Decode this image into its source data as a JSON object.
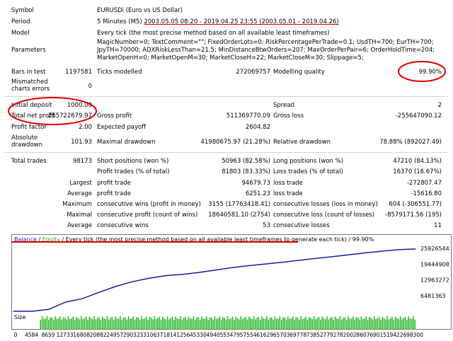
{
  "report": {
    "symbol_label": "Symbol",
    "symbol_value": "EURUSDi (Euro vs US Dollar)",
    "period_label": "Period",
    "period_prefix": "5 Minutes (M5)",
    "period_range": "2003.05.05 08:20 - 2019.04.25 23:55 (2003.05.01 - 2019.04.26)",
    "model_label": "Model",
    "model_value": "Every tick (the most precise method based on all available least timeframes)",
    "parameters_label": "Parameters",
    "parameters_value": "MagicNumber=0; TextComment=\"\"; FixedOrderLots=0; RiskPercentagePerTrade=0.1; UsdTH=700; EurTH=700; JpyTH=70000; ADXRiskLessThan=21.5; MinDistanceBtwOrders=207; MaxOrderPerPair=6; OrderHoldTime=204; MarketOpenH=0; MarketOpenM=30; MarketCloseH=22; MarketCloseM=30; Slippage=5;",
    "bars_label": "Bars in test",
    "bars_value": "1197581",
    "ticks_label": "Ticks modelled",
    "ticks_value": "272069757",
    "quality_label": "Modelling quality",
    "quality_value": "99.90%",
    "mismatch_label_1": "Mismatched",
    "mismatch_label_2": "charts errors",
    "mismatch_value": "0",
    "deposit_label": "Initial deposit",
    "deposit_value": "1000.00",
    "spread_label": "Spread",
    "spread_value": "2",
    "netprofit_label": "Total net profit",
    "netprofit_value": "255722679.97",
    "grossprofit_label": "Gross profit",
    "grossprofit_value": "511369770.09",
    "grossloss_label": "Gross loss",
    "grossloss_value": "-255647090.12",
    "pf_label": "Profit factor",
    "pf_value": "2.00",
    "payoff_label": "Expected payoff",
    "payoff_value": "2604.82",
    "absdd_label_1": "Absolute",
    "absdd_label_2": "drawdown",
    "absdd_value": "101.93",
    "maxdd_label": "Maximal drawdown",
    "maxdd_value": "41980675.97 (21.28%)",
    "reldd_label": "Relative drawdown",
    "reldd_value": "78.88% (892027.49)",
    "trades_label": "Total trades",
    "trades_value": "98173",
    "short_label": "Short positions (won %)",
    "short_value": "50963 (82.58%)",
    "long_label": "Long positions (won %)",
    "long_value": "47210 (84.13%)",
    "ptrades_label": "Profit trades (% of total)",
    "ptrades_value": "81803 (83.33%)",
    "ltrades_label": "Loss trades (% of total)",
    "ltrades_value": "16370 (16.67%)",
    "largest_label": "Largest",
    "largest_p_label": "profit trade",
    "largest_p_value": "94679.73",
    "largest_l_label": "loss trade",
    "largest_l_value": "-272807.47",
    "average_label": "Average",
    "average_p_label": "profit trade",
    "average_p_value": "6251.23",
    "average_l_label": "loss trade",
    "average_l_value": "-15616.80",
    "maximum_label": "Maximum",
    "maxwins_label": "consecutive wins (profit in money)",
    "maxwins_value": "3155 (17763418.41)",
    "maxlosses_label": "consecutive losses (loss in money)",
    "maxlosses_value": "604 (-306551.77)",
    "maximal_label": "Maximal",
    "maxprofit_label": "consecutive profit (count of wins)",
    "maxprofit_value": "18640581.10 (2754)",
    "maxloss_label": "consecutive loss (count of losses)",
    "maxloss_value": "-8579171.56 (195)",
    "avgcons_label": "Average",
    "avgwins_label": "consecutive wins",
    "avgwins_value": "53",
    "avglosses_label": "consecutive losses",
    "avglosses_value": "11"
  },
  "chart": {
    "legend_balance": "Balance",
    "legend_sep": " / ",
    "legend_equity": "Equity",
    "legend_rest": " / Every tick (the most precise method based on all available least timeframes to generate each tick) / 99.90%",
    "volume_label": "Size",
    "colors": {
      "balance": "#1a1aa8",
      "equity": "#2aa02a",
      "volume": "#12b012",
      "highlight": "#e00000"
    }
  },
  "chart_data": {
    "type": "line",
    "title": "",
    "series": [
      {
        "name": "Balance",
        "x": [
          0,
          4584,
          8659,
          12733,
          16808,
          20882,
          24957,
          29032,
          33106,
          37181,
          41256,
          45330,
          49405,
          53479,
          57554,
          61629,
          65703,
          69778,
          73852,
          77927,
          82002,
          86076,
          90151,
          94226,
          98300
        ],
        "y": [
          1000,
          1000,
          800000,
          3800000,
          5200000,
          7800000,
          10200000,
          12200000,
          13600000,
          14700000,
          15200000,
          16000000,
          17000000,
          18000000,
          18800000,
          19500000,
          20200000,
          21000000,
          21800000,
          22500000,
          23300000,
          24100000,
          24800000,
          25400000,
          25700000
        ]
      }
    ],
    "yticks": [
      "25926544",
      "19444908",
      "12963272",
      "6481363"
    ],
    "xticks": [
      "0",
      "4584",
      "8659",
      "12733",
      "16808",
      "20882",
      "24957",
      "29032",
      "33106",
      "37181",
      "41256",
      "45330",
      "49405",
      "53479",
      "57554",
      "61629",
      "65703",
      "69778",
      "73852",
      "77927",
      "82002",
      "86076",
      "90151",
      "94226",
      "98300"
    ],
    "ylim": [
      0,
      28000000
    ],
    "xlim": [
      0,
      98300
    ]
  }
}
